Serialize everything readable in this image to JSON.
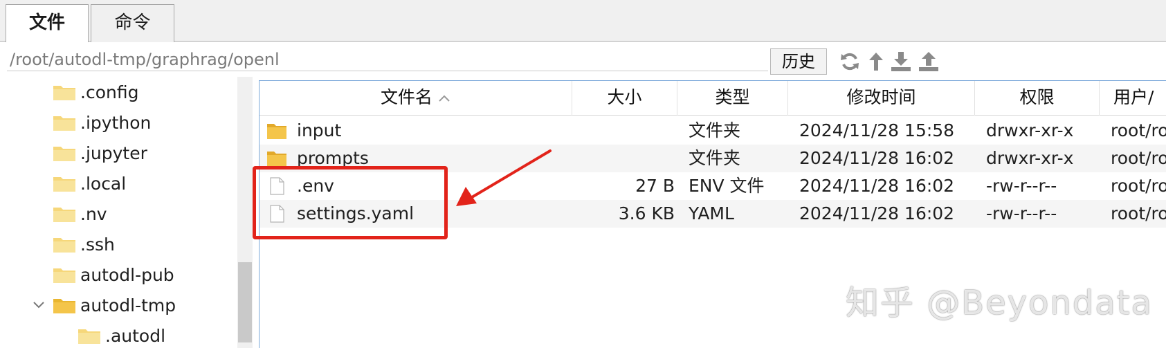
{
  "tabs": [
    {
      "label": "文件",
      "active": true
    },
    {
      "label": "命令",
      "active": false
    }
  ],
  "path": {
    "value": "/root/autodl-tmp/graphrag/openl",
    "history_label": "历史"
  },
  "toolbar_icons": [
    "refresh-icon",
    "up-arrow-icon",
    "download-icon",
    "upload-icon"
  ],
  "tree": {
    "items": [
      {
        "label": ".config",
        "level": 1
      },
      {
        "label": ".ipython",
        "level": 1
      },
      {
        "label": ".jupyter",
        "level": 1
      },
      {
        "label": ".local",
        "level": 1
      },
      {
        "label": ".nv",
        "level": 1
      },
      {
        "label": ".ssh",
        "level": 1
      },
      {
        "label": "autodl-pub",
        "level": 1
      },
      {
        "label": "autodl-tmp",
        "level": 1,
        "expanded": true
      },
      {
        "label": ".autodl",
        "level": 2
      }
    ]
  },
  "filelist": {
    "columns": {
      "name": "文件名",
      "size": "大小",
      "type": "类型",
      "mtime": "修改时间",
      "perm": "权限",
      "owner": "用户/"
    },
    "sort_column": "name",
    "sort_direction": "ascending",
    "rows": [
      {
        "icon": "folder-icon",
        "name": "input",
        "size": "",
        "type": "文件夹",
        "mtime": "2024/11/28 15:58",
        "perm": "drwxr-xr-x",
        "owner": "root/ro"
      },
      {
        "icon": "folder-icon",
        "name": "prompts",
        "size": "",
        "type": "文件夹",
        "mtime": "2024/11/28 16:02",
        "perm": "drwxr-xr-x",
        "owner": "root/ro"
      },
      {
        "icon": "file-icon",
        "name": ".env",
        "size": "27 B",
        "type": "ENV 文件",
        "mtime": "2024/11/28 16:02",
        "perm": "-rw-r--r--",
        "owner": "root/ro"
      },
      {
        "icon": "file-icon",
        "name": "settings.yaml",
        "size": "3.6 KB",
        "type": "YAML",
        "mtime": "2024/11/28 16:02",
        "perm": "-rw-r--r--",
        "owner": "root/ro"
      }
    ]
  },
  "annotation": {
    "color": "#e2231a"
  },
  "colors": {
    "folder": "#f4c54a",
    "folder_dark": "#e2a92a",
    "accent_border": "#7aa7d9"
  },
  "watermark": "知乎 @Beyondata"
}
